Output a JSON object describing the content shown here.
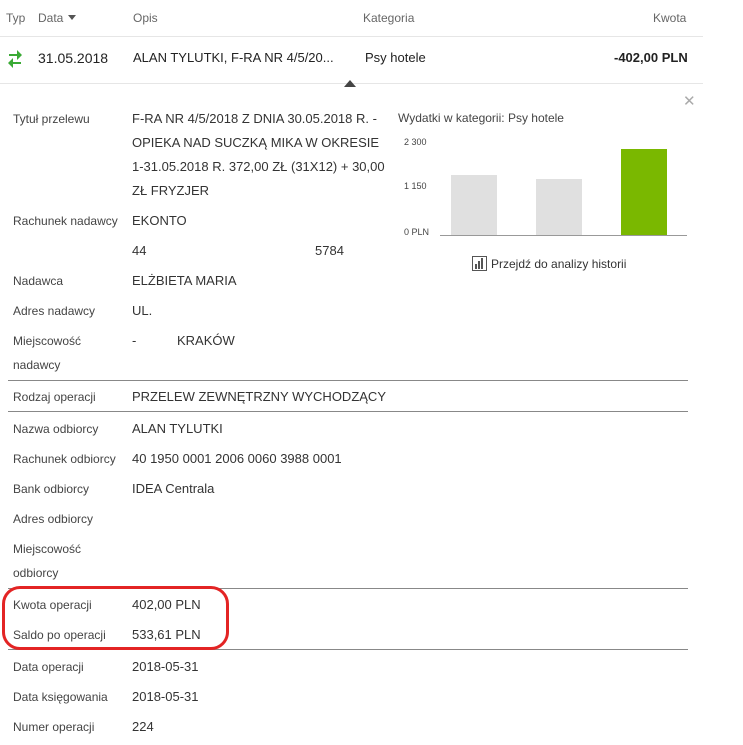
{
  "header": {
    "typ": "Typ",
    "data": "Data",
    "opis": "Opis",
    "kategoria": "Kategoria",
    "kwota": "Kwota"
  },
  "transaction": {
    "icon": "transfer-icon",
    "icon_color": "#3aaa35",
    "date": "31.05.2018",
    "description": "ALAN TYLUTKI, F-RA NR 4/5/20...",
    "category": "Psy hotele",
    "amount": "-402,00 PLN"
  },
  "details": {
    "title_label": "Tytuł przelewu",
    "title_lines": [
      "F-RA NR 4/5/2018 Z DNIA 30.05.2018 R. -",
      "OPIEKA NAD SUCZKĄ MIKA W OKRESIE",
      "1-31.05.2018 R. 372,00 ZŁ (31X12) + 30,00",
      "ZŁ FRYZJER"
    ],
    "sender_account_label": "Rachunek nadawcy",
    "sender_account_name": "EKONTO",
    "sender_account_start": "44",
    "sender_account_end": "5784",
    "sender_label": "Nadawca",
    "sender": "ELŻBIETA MARIA",
    "sender_address_label": "Adres nadawcy",
    "sender_address": "UL.",
    "sender_city_label_1": "Miejscowość",
    "sender_city_label_2": "nadawcy",
    "sender_city_dash": "-",
    "sender_city": "KRAKÓW",
    "operation_type_label": "Rodzaj operacji",
    "operation_type": "PRZELEW ZEWNĘTRZNY WYCHODZĄCY",
    "recipient_label": "Nazwa odbiorcy",
    "recipient": "ALAN TYLUTKI",
    "recipient_account_label": "Rachunek odbiorcy",
    "recipient_account": "40 1950 0001 2006 0060 3988 0001",
    "recipient_bank_label": "Bank odbiorcy",
    "recipient_bank": "IDEA Centrala",
    "recipient_address_label": "Adres odbiorcy",
    "recipient_city_label_1": "Miejscowość",
    "recipient_city_label_2": "odbiorcy",
    "amount_label": "Kwota operacji",
    "amount": "402,00 PLN",
    "balance_label": "Saldo po operacji",
    "balance": "533,61 PLN",
    "operation_date_label": "Data operacji",
    "operation_date": "2018-05-31",
    "booking_date_label": "Data księgowania",
    "booking_date": "2018-05-31",
    "operation_number_label": "Numer operacji",
    "operation_number": "224"
  },
  "chart_data": {
    "type": "bar",
    "title": "Wydatki w kategorii:",
    "category_name": "Psy hotele",
    "y_ticks": [
      "2 300",
      "1 150",
      "0 PLN"
    ],
    "ylim": [
      0,
      2300
    ],
    "values": [
      1600,
      1500,
      2300
    ],
    "colors": [
      "#e0e0e0",
      "#e0e0e0",
      "#7ab800"
    ],
    "categories": [
      "",
      "",
      ""
    ]
  },
  "analysis_link": "Przejdź do analizy historii",
  "highlight_color": "#e32424"
}
